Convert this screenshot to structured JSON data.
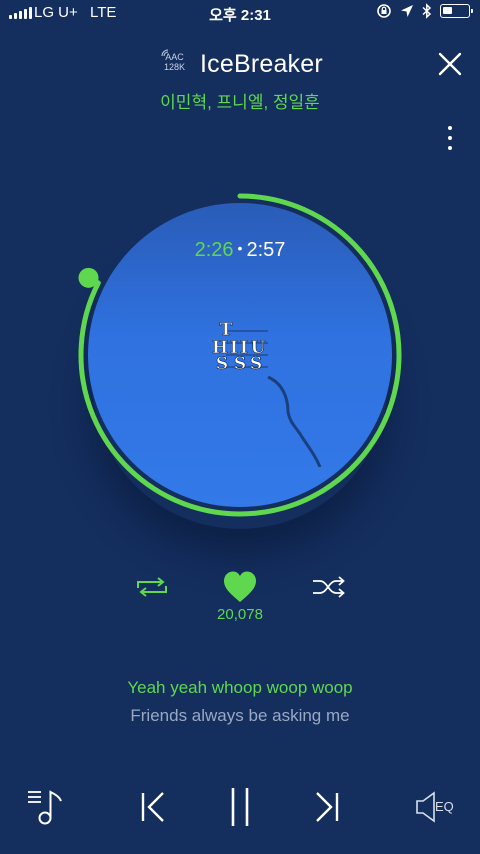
{
  "status_bar": {
    "carrier": "LG U+",
    "network": "LTE",
    "time": "오후 2:31"
  },
  "header": {
    "codec_line1": "AAC",
    "codec_line2": "128K",
    "title": "IceBreaker",
    "artists": "이민혁, 프니엘, 정일훈"
  },
  "player": {
    "elapsed": "2:26",
    "separator": "•",
    "total": "2:57",
    "progress_fraction": 0.825,
    "album_art_letters": [
      "T",
      "H",
      "I",
      "I",
      "U",
      "S",
      "S",
      "S"
    ]
  },
  "actions": {
    "like_count": "20,078"
  },
  "lyrics": {
    "current": "Yeah yeah whoop woop woop",
    "next": "Friends always be asking me"
  },
  "bottom_bar": {
    "eq_label": "EQ"
  },
  "colors": {
    "background": "#142e5e",
    "accent": "#5fd84f",
    "disc": "#2f72e0"
  },
  "icons": [
    "repeat-icon",
    "heart-icon",
    "shuffle-icon",
    "playlist-icon",
    "previous-icon",
    "pause-icon",
    "next-icon",
    "eq-icon",
    "close-icon",
    "more-icon"
  ]
}
